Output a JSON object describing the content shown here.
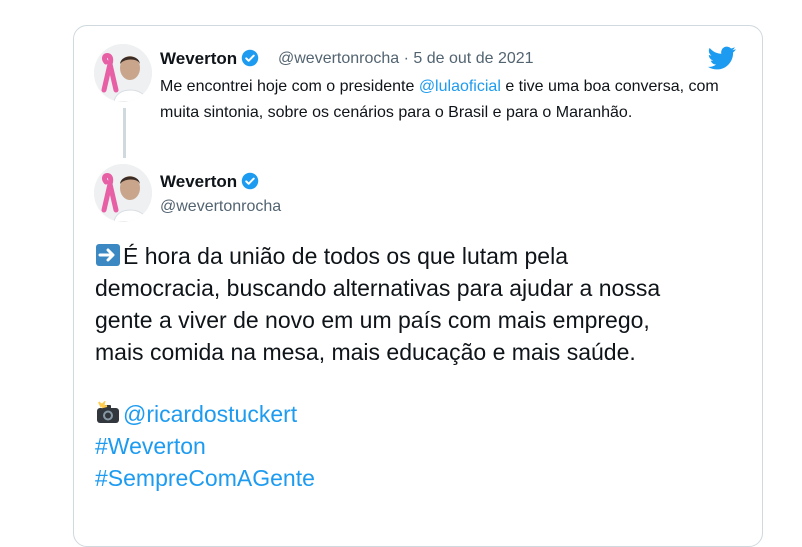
{
  "reply": {
    "name": "Weverton",
    "handle": "@wevertonrocha",
    "separator": "·",
    "date": "5 de out de 2021",
    "text_before": "Me encontrei hoje com o presidente ",
    "mention": "@lulaoficial",
    "text_after": " e tive uma boa conversa, com muita sintonia, sobre os cenários para o Brasil e para o Maranhão."
  },
  "main": {
    "name": "Weverton",
    "handle": "@wevertonrocha",
    "lines": [
      "É hora da união de todos os que lutam pela",
      "democracia, buscando alternativas para ajudar a nossa",
      "gente a viver de novo em um país com mais emprego,",
      "mais comida na mesa, mais educação e mais saúde."
    ],
    "photo_credit": "@ricardostuckert",
    "hashtags": [
      "#Weverton",
      "#SempreComAGente"
    ]
  },
  "colors": {
    "link": "#1d9bf0",
    "text": "#0f1419",
    "secondary": "#536471",
    "border": "#cfd9de",
    "ribbon": "#e75fa5"
  },
  "icons": {
    "logo": "twitter-bird-icon",
    "verified": "verified-badge-icon",
    "arrow": "right-arrow-emoji-icon",
    "camera": "camera-flash-emoji-icon"
  }
}
